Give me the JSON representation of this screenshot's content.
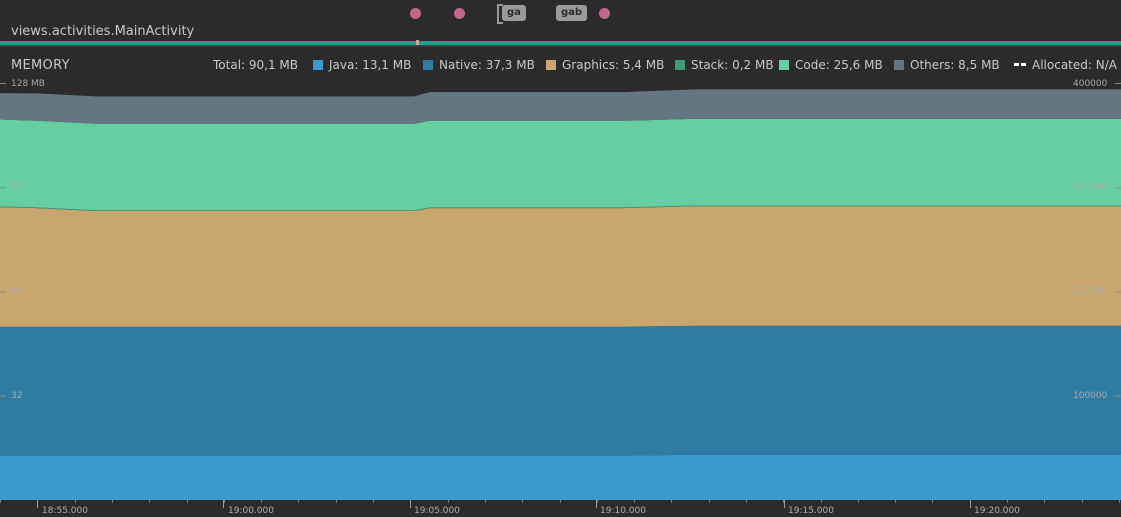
{
  "header": {
    "activity": "views.activities.MainActivity",
    "tags": [
      "ga",
      "gab"
    ]
  },
  "memory": {
    "title": "MEMORY",
    "total": "Total: 90,1 MB",
    "legend": [
      {
        "name": "Java",
        "label": "Java: 13,1 MB",
        "color": "#3b9acd"
      },
      {
        "name": "Native",
        "label": "Native: 37,3 MB",
        "color": "#2e7ca2"
      },
      {
        "name": "Graphics",
        "label": "Graphics: 5,4 MB",
        "color": "#c9a66d"
      },
      {
        "name": "Stack",
        "label": "Stack: 0,2 MB",
        "color": "#3e9b74"
      },
      {
        "name": "Code",
        "label": "Code: 25,6 MB",
        "color": "#65cfa1"
      },
      {
        "name": "Others",
        "label": "Others: 8,5 MB",
        "color": "#637682"
      }
    ],
    "allocated": "Allocated: N/A"
  },
  "axes": {
    "left_labels": [
      "128 MB",
      "96",
      "64",
      "32"
    ],
    "right_labels": [
      "400000",
      "300000",
      "200000",
      "100000"
    ],
    "time_labels": [
      "18:55.000",
      "19:00.000",
      "19:05.000",
      "19:10.000",
      "19:15.000",
      "19:20.000"
    ]
  },
  "chart_data": {
    "type": "area",
    "stacked": true,
    "x": [
      "18:53",
      "18:55",
      "18:56",
      "19:00",
      "19:04",
      "19:05",
      "19:10",
      "19:12",
      "19:15",
      "19:20",
      "19:25"
    ],
    "ylim": [
      0,
      128
    ],
    "y2lim": [
      0,
      400000
    ],
    "series": [
      {
        "name": "Java",
        "values": [
          13.6,
          13.6,
          13.6,
          13.6,
          13.6,
          13.6,
          13.6,
          13.9,
          13.9,
          13.9,
          13.9
        ]
      },
      {
        "name": "Native",
        "values": [
          39.6,
          39.6,
          39.6,
          39.6,
          39.6,
          39.6,
          39.6,
          39.6,
          39.6,
          39.6,
          39.6
        ]
      },
      {
        "name": "Graphics",
        "values": [
          36.7,
          36.4,
          35.5,
          35.5,
          35.5,
          36.4,
          36.4,
          36.7,
          36.7,
          36.7,
          36.7
        ]
      },
      {
        "name": "Stack",
        "values": [
          0.2,
          0.2,
          0.2,
          0.2,
          0.2,
          0.2,
          0.2,
          0.2,
          0.2,
          0.2,
          0.2
        ]
      },
      {
        "name": "Code",
        "values": [
          26.7,
          26.6,
          26.6,
          26.6,
          26.6,
          26.6,
          26.6,
          26.6,
          26.6,
          26.6,
          26.6
        ]
      },
      {
        "name": "Others",
        "values": [
          8.1,
          8.4,
          8.4,
          8.4,
          8.4,
          8.8,
          8.8,
          9.1,
          9.1,
          9.1,
          9.1
        ]
      }
    ]
  }
}
